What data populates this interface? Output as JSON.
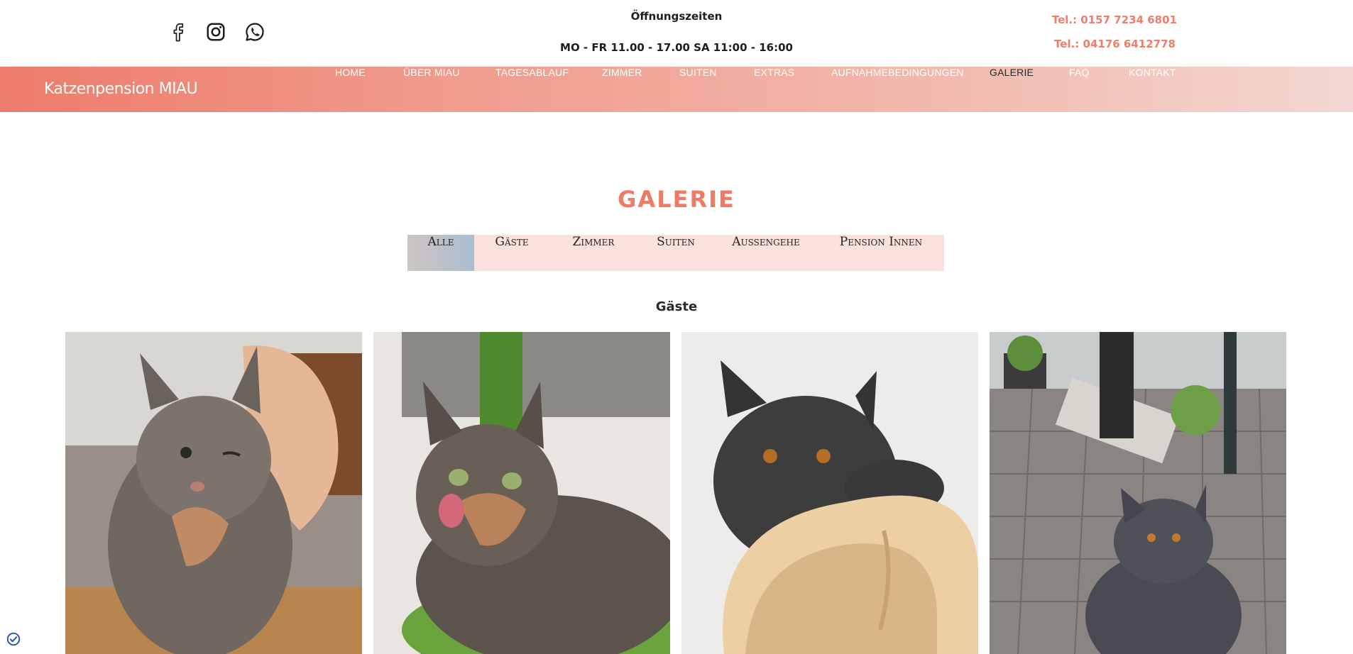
{
  "header": {
    "social_icons": [
      "facebook-icon",
      "instagram-icon",
      "whatsapp-icon"
    ],
    "hours_title": "Öffnungszeiten",
    "hours_text": "MO - FR 11.00 - 17.00 SA 11:00 - 16:00",
    "phone_1": "Tel.: 0157 7234 6801",
    "phone_2": "Tel.: 04176 6412778"
  },
  "nav": {
    "brand": "Katzenpension MIAU",
    "items": [
      {
        "label": "HOME"
      },
      {
        "label": "ÜBER MIAU"
      },
      {
        "label": "TAGESABLAUF"
      },
      {
        "label": "ZIMMER"
      },
      {
        "label": "SUITEN"
      },
      {
        "label": "EXTRAS"
      },
      {
        "label": "AUFNAHMEBEDINGUNGEN"
      },
      {
        "label": "GALERIE"
      },
      {
        "label": "FAQ"
      },
      {
        "label": "KONTAKT"
      }
    ],
    "active": "GALERIE"
  },
  "gallery": {
    "title": "GALERIE",
    "filters": [
      "Alle",
      "Gäste",
      "Zimmer",
      "Suiten",
      "Aussengehe",
      "Pension Innen"
    ],
    "active_filter": "Alle",
    "section_heading": "Gäste",
    "photos": [
      {
        "alt": "tortoiseshell-cat-being-petted"
      },
      {
        "alt": "tortoiseshell-cat-licking-nose"
      },
      {
        "alt": "grey-cat-on-plush-bed"
      },
      {
        "alt": "grey-cat-in-outdoor-enclosure"
      }
    ]
  },
  "colors": {
    "accent": "#ee7b64",
    "filter_bg": "#fbe1dc"
  }
}
